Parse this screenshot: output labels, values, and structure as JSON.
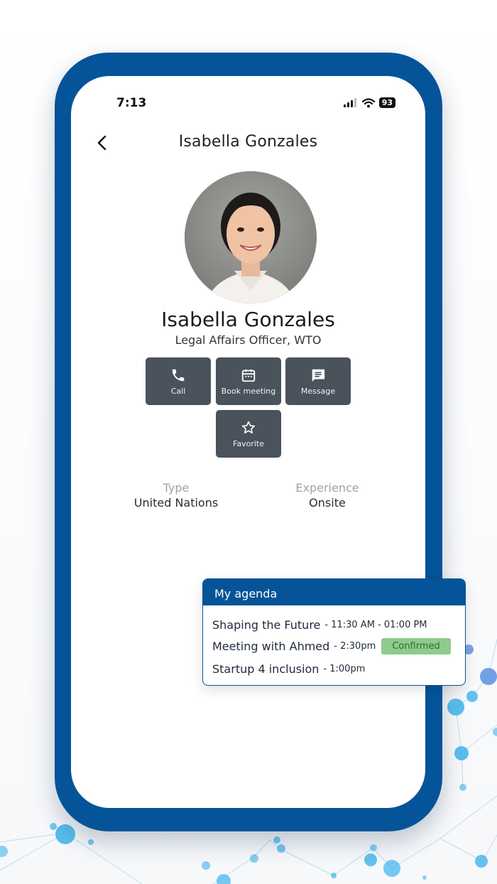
{
  "status_bar": {
    "time": "7:13",
    "battery": "93"
  },
  "header": {
    "title": "Isabella Gonzales",
    "back_icon": "chevron-left-icon"
  },
  "profile": {
    "name": "Isabella Gonzales",
    "role": "Legal Affairs Officer, WTO"
  },
  "actions": [
    {
      "label": "Call",
      "icon": "phone-icon"
    },
    {
      "label": "Book meeting",
      "icon": "calendar-icon"
    },
    {
      "label": "Message",
      "icon": "message-icon"
    },
    {
      "label": "Favorite",
      "icon": "star-icon"
    }
  ],
  "details": [
    {
      "key": "Type",
      "value": "United Nations"
    },
    {
      "key": "Experience",
      "value": "Onsite"
    }
  ],
  "agenda": {
    "title": "My agenda",
    "items": [
      {
        "title": "Shaping the Future",
        "time": "- 11:30 AM - 01:00 PM",
        "badge": ""
      },
      {
        "title": "Meeting with Ahmed",
        "time": "- 2:30pm",
        "badge": "Confirmed"
      },
      {
        "title": "Startup 4 inclusion",
        "time": "- 1:00pm",
        "badge": ""
      }
    ]
  },
  "colors": {
    "frame": "#055399",
    "action_button": "#4a525c",
    "confirmed_badge": "#8ecb8c",
    "network_dots": "#3fb4ec"
  }
}
